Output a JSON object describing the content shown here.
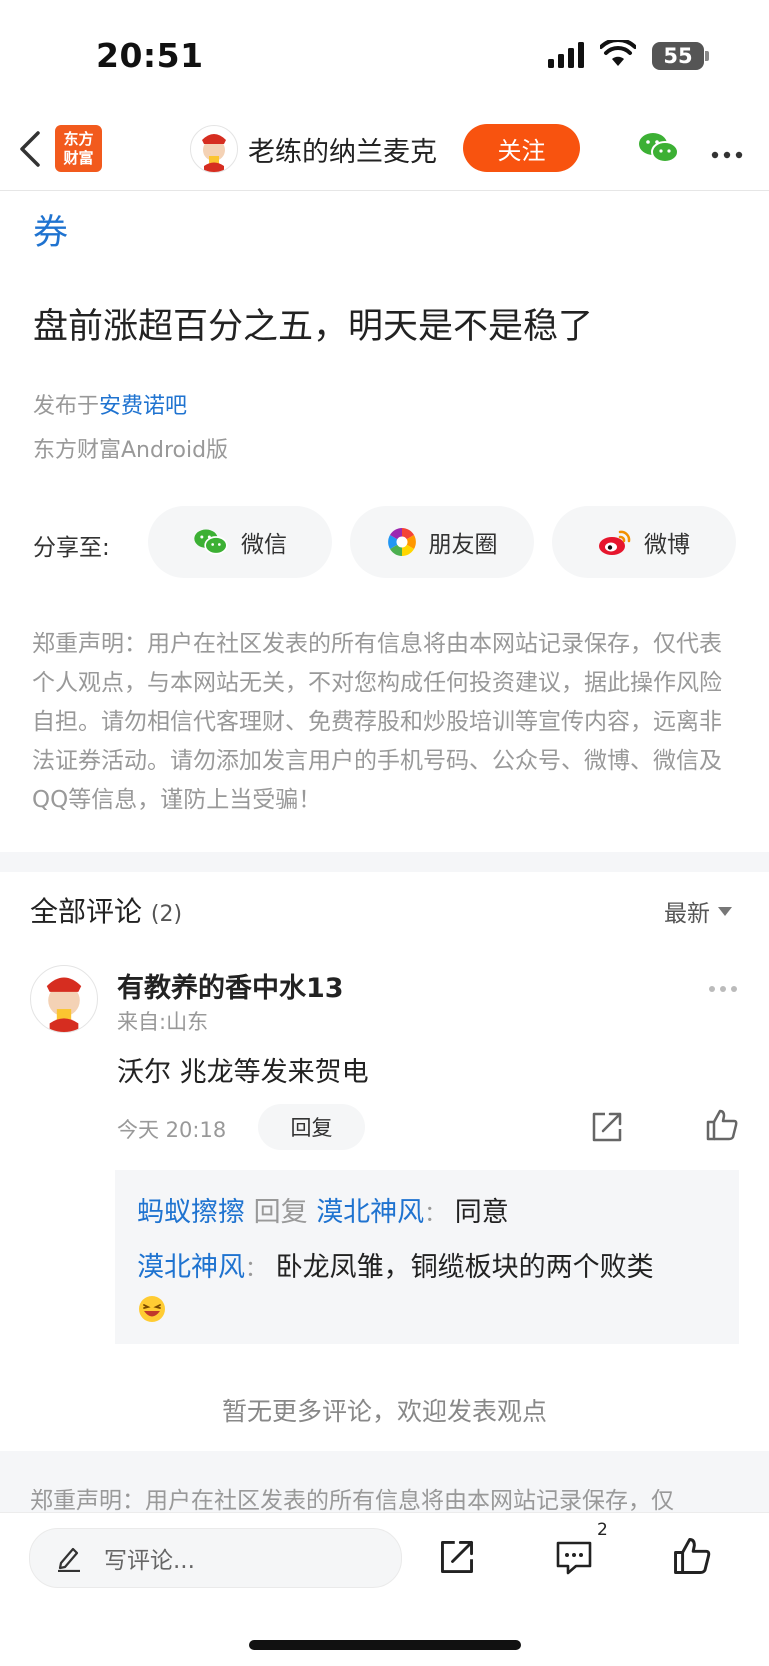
{
  "status_bar": {
    "time": "20:51",
    "battery": "55"
  },
  "header": {
    "logo_line1": "东方",
    "logo_line2": "财富",
    "author_name": "老练的纳兰麦克",
    "follow_label": "关注"
  },
  "article": {
    "partial_text": "券",
    "title": "盘前涨超百分之五，明天是不是稳了",
    "published_prefix": "发布于",
    "published_forum": "安费诺吧",
    "client": "东方财富Android版"
  },
  "share": {
    "label": "分享至:",
    "wechat": "微信",
    "moments": "朋友圈",
    "weibo": "微博"
  },
  "disclaimer": "郑重声明：用户在社区发表的所有信息将由本网站记录保存，仅代表个人观点，与本网站无关，不对您构成任何投资建议，据此操作风险自担。请勿相信代客理财、免费荐股和炒股培训等宣传内容，远离非法证券活动。请勿添加发言用户的手机号码、公众号、微博、微信及QQ等信息，谨防上当受骗！",
  "comments": {
    "title": "全部评论",
    "count": "(2)",
    "sort_label": "最新",
    "items": [
      {
        "username": "有教养的香中水13",
        "location": "来自:山东",
        "text": "沃尔 兆龙等发来贺电",
        "time": "今天 20:18",
        "reply_button": "回复",
        "replies": [
          {
            "from": "蚂蚁擦擦",
            "reply_word": "回复",
            "to": "漠北神风",
            "colon": "：",
            "text": "同意"
          },
          {
            "from": "漠北神风",
            "colon": "：",
            "text": "卧龙凤雏，铜缆板块的两个败类"
          }
        ]
      }
    ],
    "no_more": "暂无更多评论，欢迎发表观点"
  },
  "disclaimer_repeat": "郑重声明：用户在社区发表的所有信息将由本网站记录保存，仅",
  "bottom_bar": {
    "comment_placeholder": "写评论...",
    "comment_count": "2"
  },
  "colors": {
    "accent_orange": "#f8530f",
    "link_blue": "#1f73d0",
    "wechat_green": "#3cb034",
    "weibo_red": "#e6162d"
  }
}
